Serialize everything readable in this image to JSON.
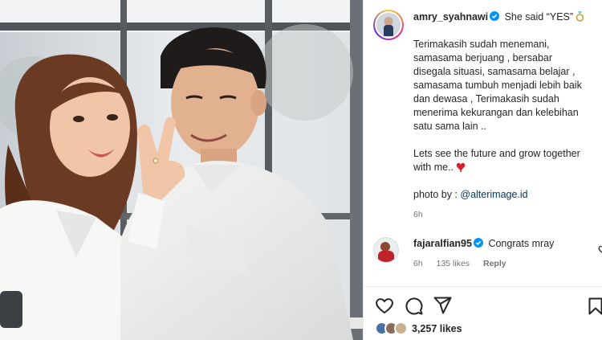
{
  "post": {
    "username": "amry_syahnawi",
    "caption_headline": "She said “YES”",
    "caption_paragraph_1": "Terimakasih sudah menemani,\nsamasama berjuang , bersabar\ndisegala situasi, samasama belajar ,\nsamasama tumbuh menjadi lebih baik\ndan dewasa , Terimakasih sudah\nmenerima kekurangan dan kelebihan\nsatu sama lain ..",
    "caption_paragraph_2": "Lets see the future and grow together\nwith me..",
    "photo_credit_label": "photo by : ",
    "photo_credit_mention": "@alterimage.id",
    "time": "6h"
  },
  "comment": {
    "username": "fajaralfian95",
    "text": "Congrats mray",
    "time": "6h",
    "likes": "135 likes",
    "reply_label": "Reply"
  },
  "footer": {
    "likes_count": "3,257 likes"
  },
  "icons": {
    "verified": "verified-badge-icon",
    "ring": "ring-emoji-icon",
    "heart": "red-heart-emoji-icon",
    "like": "heart-icon",
    "comment": "comment-icon",
    "share": "share-icon",
    "save": "bookmark-icon"
  },
  "colors": {
    "verified_blue": "#0095f6",
    "link_blue": "#00376b",
    "meta_gray": "#737373"
  }
}
